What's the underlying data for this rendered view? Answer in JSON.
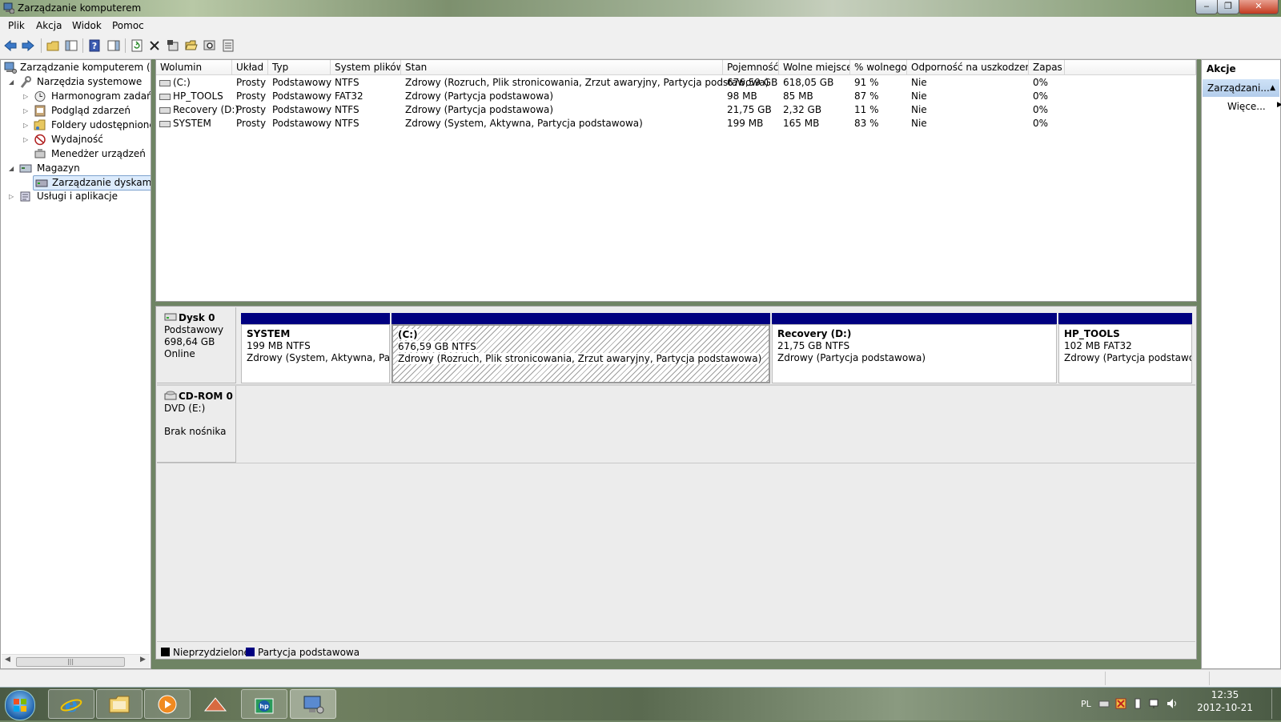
{
  "window": {
    "title": "Zarządzanie komputerem"
  },
  "menu": [
    "Plik",
    "Akcja",
    "Widok",
    "Pomoc"
  ],
  "toolbar": [
    "back-icon",
    "forward-icon",
    "up-folder-icon",
    "show-hide-tree-icon",
    "help-icon",
    "show-hide-action-pane-icon",
    "refresh-icon",
    "delete-icon",
    "properties-icon",
    "open-icon",
    "search-icon",
    "export-icon"
  ],
  "tree": {
    "root": "Zarządzanie komputerem (lokalny)",
    "system_tools": "Narzędzia systemowe",
    "task_scheduler": "Harmonogram zadań",
    "event_viewer": "Podgląd zdarzeń",
    "shared_folders": "Foldery udostępnione",
    "performance": "Wydajność",
    "device_manager": "Menedżer urządzeń",
    "storage": "Magazyn",
    "disk_management": "Zarządzanie dyskami",
    "services": "Usługi i aplikacje"
  },
  "volumes": {
    "headers": [
      "Wolumin",
      "Układ",
      "Typ",
      "System plików",
      "Stan",
      "Pojemność",
      "Wolne miejsce",
      "% wolnego",
      "Odporność na uszkodzenia",
      "Zapas"
    ],
    "rows": [
      [
        "(C:)",
        "Prosty",
        "Podstawowy",
        "NTFS",
        "Zdrowy (Rozruch, Plik stronicowania, Zrzut awaryjny, Partycja podstawowa)",
        "676,59 GB",
        "618,05 GB",
        "91 %",
        "Nie",
        "0%"
      ],
      [
        "HP_TOOLS",
        "Prosty",
        "Podstawowy",
        "FAT32",
        "Zdrowy (Partycja podstawowa)",
        "98 MB",
        "85 MB",
        "87 %",
        "Nie",
        "0%"
      ],
      [
        "Recovery (D:)",
        "Prosty",
        "Podstawowy",
        "NTFS",
        "Zdrowy (Partycja podstawowa)",
        "21,75 GB",
        "2,32 GB",
        "11 %",
        "Nie",
        "0%"
      ],
      [
        "SYSTEM",
        "Prosty",
        "Podstawowy",
        "NTFS",
        "Zdrowy (System, Aktywna, Partycja podstawowa)",
        "199 MB",
        "165 MB",
        "83 %",
        "Nie",
        "0%"
      ]
    ]
  },
  "disk0": {
    "name": "Dysk 0",
    "kind": "Podstawowy",
    "size": "698,64 GB",
    "status": "Online",
    "partitions": [
      {
        "name": "SYSTEM",
        "size": "199 MB NTFS",
        "status": "Zdrowy (System, Aktywna, Partycja podstawowa)"
      },
      {
        "name": "(C:)",
        "size": "676,59 GB NTFS",
        "status": "Zdrowy (Rozruch, Plik stronicowania, Zrzut awaryjny, Partycja podstawowa)"
      },
      {
        "name": "Recovery  (D:)",
        "size": "21,75 GB NTFS",
        "status": "Zdrowy (Partycja podstawowa)"
      },
      {
        "name": "HP_TOOLS",
        "size": "102 MB FAT32",
        "status": "Zdrowy (Partycja podstawowa)"
      }
    ]
  },
  "cdrom": {
    "name": "CD-ROM 0",
    "drive": "DVD (E:)",
    "status": "Brak nośnika"
  },
  "legend": {
    "unallocated": "Nieprzydzielone",
    "primary": "Partycja podstawowa"
  },
  "actions": {
    "title": "Akcje",
    "section": "Zarządzani...",
    "more": "Więce..."
  },
  "tray": {
    "lang": "PL",
    "time": "12:35",
    "date": "2012-10-21"
  },
  "colors": {
    "partition_bar": "#000080",
    "unallocated": "#000000"
  }
}
